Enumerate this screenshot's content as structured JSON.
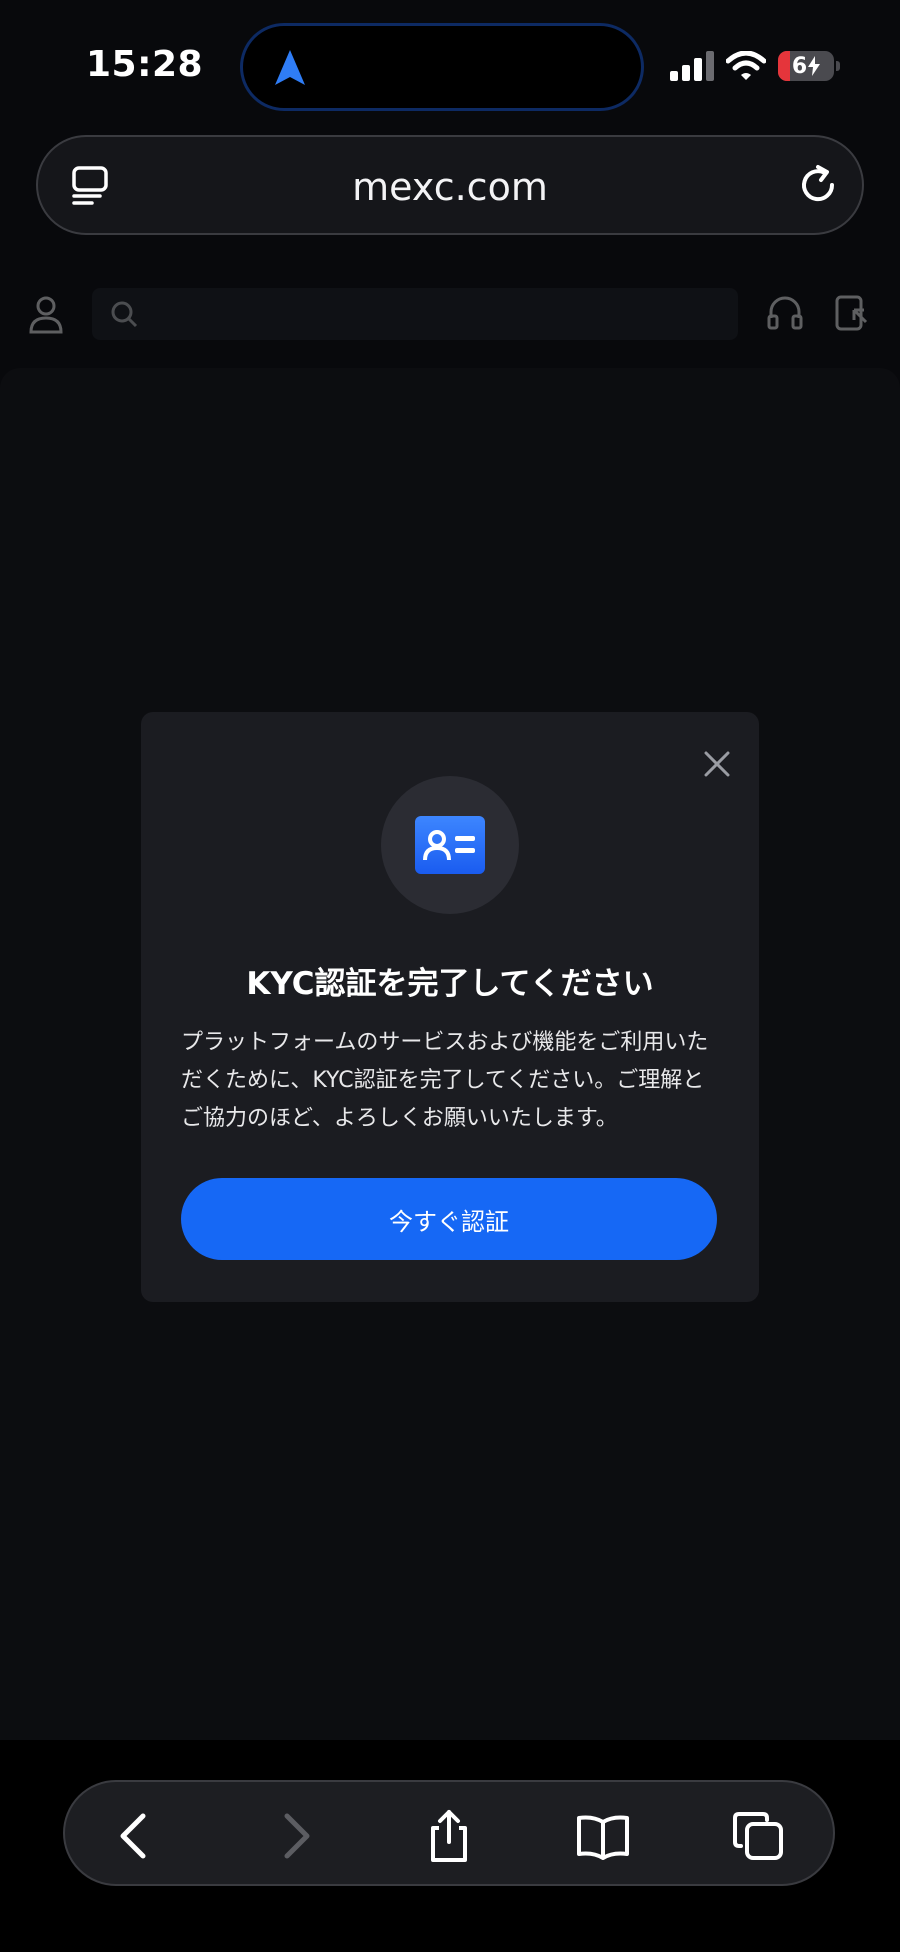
{
  "status_bar": {
    "time": "15:28",
    "battery_percent": "6",
    "battery_charging": true,
    "cellular_icon": "signal-bars-icon",
    "wifi_icon": "wifi-icon",
    "live_activity_icon": "navigation-arrow-icon"
  },
  "address_bar": {
    "url": "mexc.com",
    "left_icon": "reader-format-icon",
    "right_icon": "reload-icon"
  },
  "modal": {
    "title": "KYC認証を完了してください",
    "body": "プラットフォームのサービスおよび機能をご利用いただくために、KYC認証を完了してください。ご理解とご協力のほど、よろしくお願いいたします。",
    "button_label": "今すぐ認証",
    "icon": "id-card-icon",
    "close_icon": "close-icon"
  },
  "toolbar": {
    "items": [
      "back-icon",
      "forward-icon",
      "share-icon",
      "bookmarks-icon",
      "tabs-icon"
    ]
  },
  "colors": {
    "accent": "#1668f5",
    "modal_bg": "#1b1c21",
    "page_bg": "#08090c",
    "island_border": "#0d2a63",
    "nav_arrow": "#2f7df6"
  }
}
